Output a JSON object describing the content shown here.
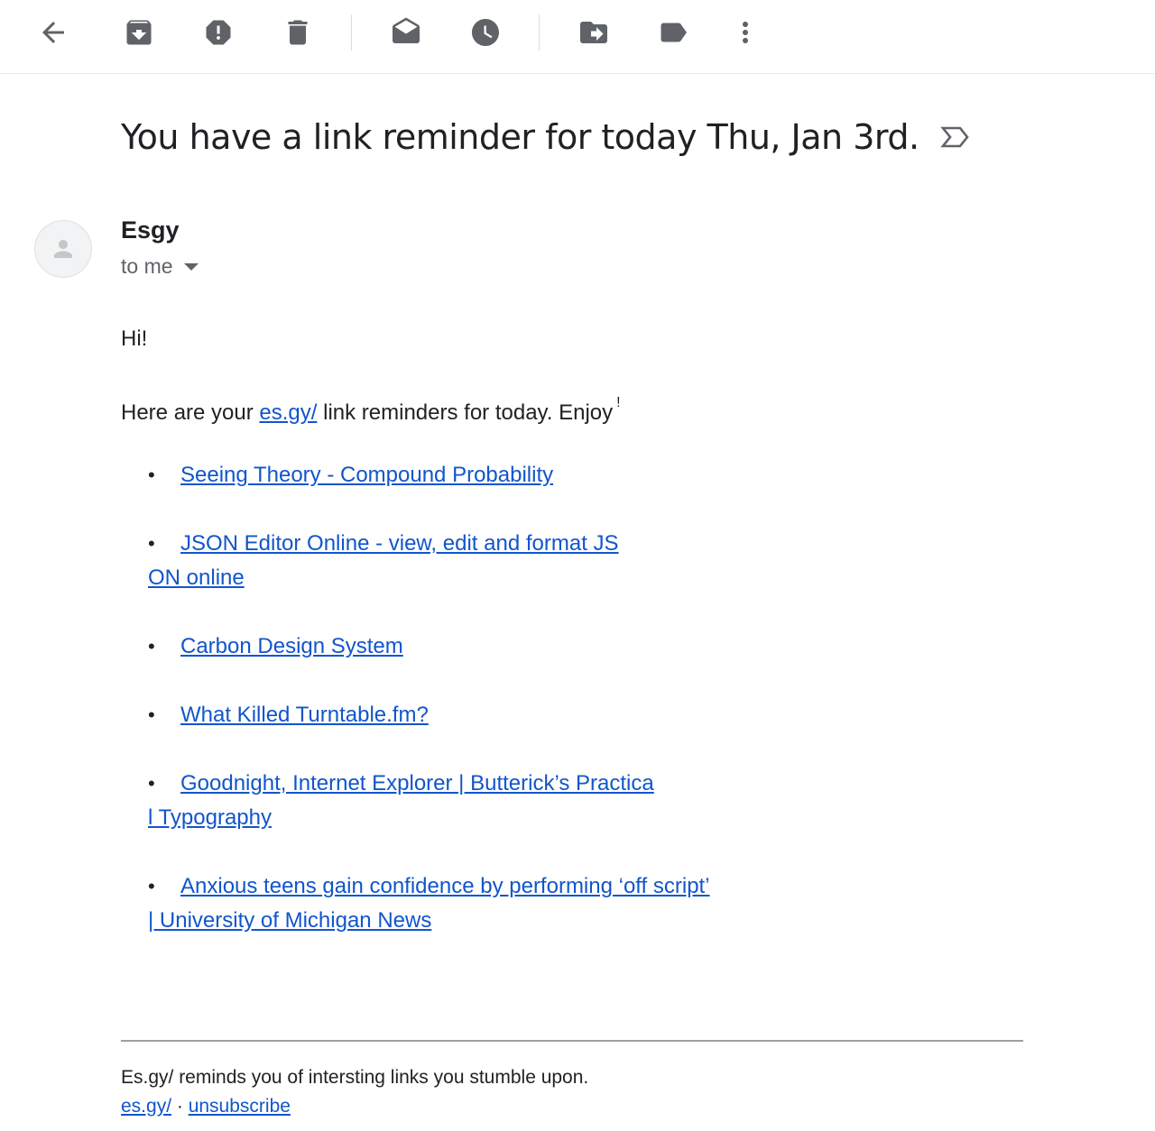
{
  "toolbar": {
    "icons": [
      "back-arrow-icon",
      "archive-icon",
      "report-spam-icon",
      "delete-icon",
      "mark-unread-icon",
      "snooze-icon",
      "move-to-icon",
      "label-icon",
      "more-vert-icon"
    ]
  },
  "email": {
    "subject": "You have a link reminder for today Thu, Jan 3rd.",
    "sender": "Esgy",
    "recipient": "to me",
    "greeting": "Hi!",
    "intro_before": "Here are your ",
    "intro_link": "es.gy/",
    "intro_after": " link reminders for today. Enjoy",
    "intro_sup": "!",
    "links": [
      {
        "line1": "Seeing Theory - Compound Probability",
        "line2": ""
      },
      {
        "line1": "JSON Editor Online - view, edit and format JS",
        "line2": "ON online"
      },
      {
        "line1": "Carbon Design System",
        "line2": ""
      },
      {
        "line1": "What Killed Turntable.fm?",
        "line2": ""
      },
      {
        "line1": "Goodnight, Internet Explorer | Butterick’s Practica",
        "line2": "l Typography"
      },
      {
        "line1": "Anxious teens gain confidence by performing ‘off script’",
        "line2": "| University of Michigan News"
      }
    ],
    "bullet": "•"
  },
  "footer": {
    "tagline": "Es.gy/ reminds you of intersting links you stumble upon.",
    "home_link": "es.gy/",
    "separator": " · ",
    "unsubscribe": "unsubscribe"
  },
  "colors": {
    "link": "#1155cc",
    "icon": "#5f6368",
    "text": "#202124"
  }
}
